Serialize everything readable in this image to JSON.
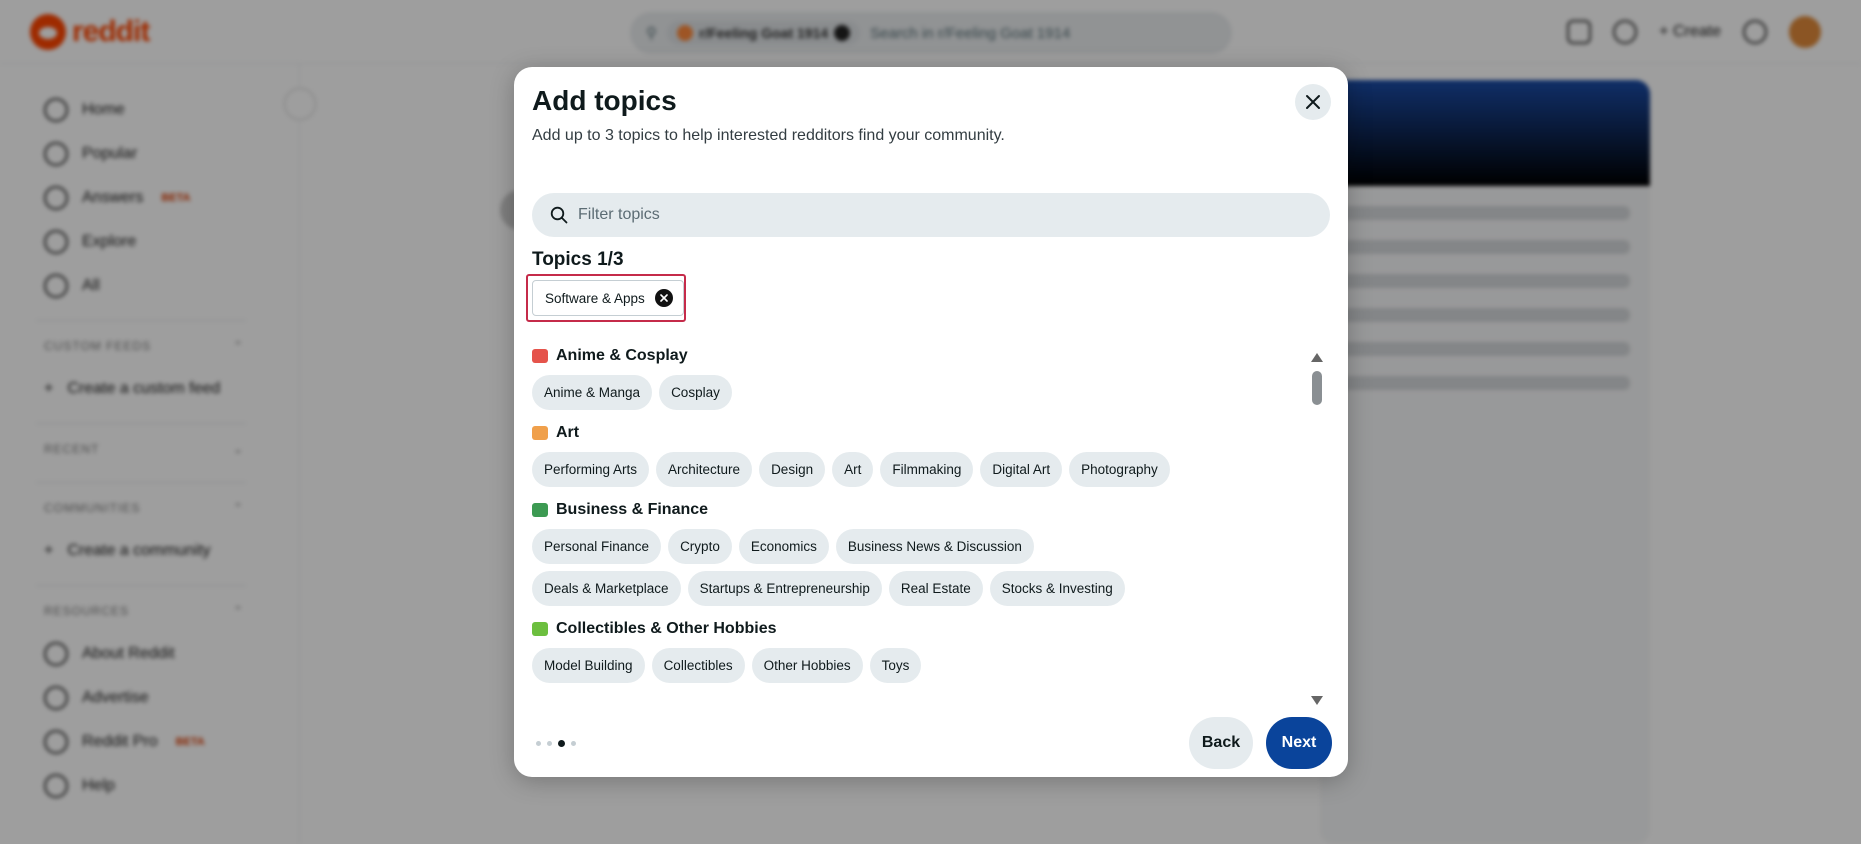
{
  "background": {
    "brand": "reddit",
    "search_chip": "r/Feeling Goat 1914",
    "search_placeholder": "Search in r/Feeling Goat 1914",
    "create_label": "Create",
    "nav": [
      "Home",
      "Popular",
      "Answers",
      "Explore",
      "All"
    ],
    "answers_badge": "BETA",
    "sections": {
      "custom_feeds": "CUSTOM FEEDS",
      "create_custom_feed": "Create a custom feed",
      "recent": "RECENT",
      "communities": "COMMUNITIES",
      "create_community": "Create a community",
      "resources": "RESOURCES"
    },
    "resources": [
      "About Reddit",
      "Advertise",
      "Reddit Pro",
      "Help"
    ],
    "reddit_pro_badge": "BETA"
  },
  "modal": {
    "title": "Add topics",
    "subtitle": "Add up to 3 topics to help interested redditors find your community.",
    "filter_placeholder": "Filter topics",
    "topics_count": "Topics 1/3",
    "selected": [
      "Software & Apps"
    ],
    "categories": [
      {
        "name": "Anime & Cosplay",
        "emoji_color": "#e5534b",
        "topics": [
          "Anime & Manga",
          "Cosplay"
        ]
      },
      {
        "name": "Art",
        "emoji_color": "#f0a04b",
        "topics": [
          "Performing Arts",
          "Architecture",
          "Design",
          "Art",
          "Filmmaking",
          "Digital Art",
          "Photography"
        ]
      },
      {
        "name": "Business & Finance",
        "emoji_color": "#3c9a52",
        "topics": [
          "Personal Finance",
          "Crypto",
          "Economics",
          "Business News & Discussion",
          "Deals & Marketplace",
          "Startups & Entrepreneurship",
          "Real Estate",
          "Stocks & Investing"
        ]
      },
      {
        "name": "Collectibles & Other Hobbies",
        "emoji_color": "#6cbf3f",
        "topics": [
          "Model Building",
          "Collectibles",
          "Other Hobbies",
          "Toys"
        ]
      }
    ],
    "steps": {
      "total": 4,
      "current": 3
    },
    "back_label": "Back",
    "next_label": "Next",
    "colors": {
      "primary": "#0a449b",
      "chip_bg": "#e5ebee",
      "highlight": "#c52b4a"
    }
  }
}
